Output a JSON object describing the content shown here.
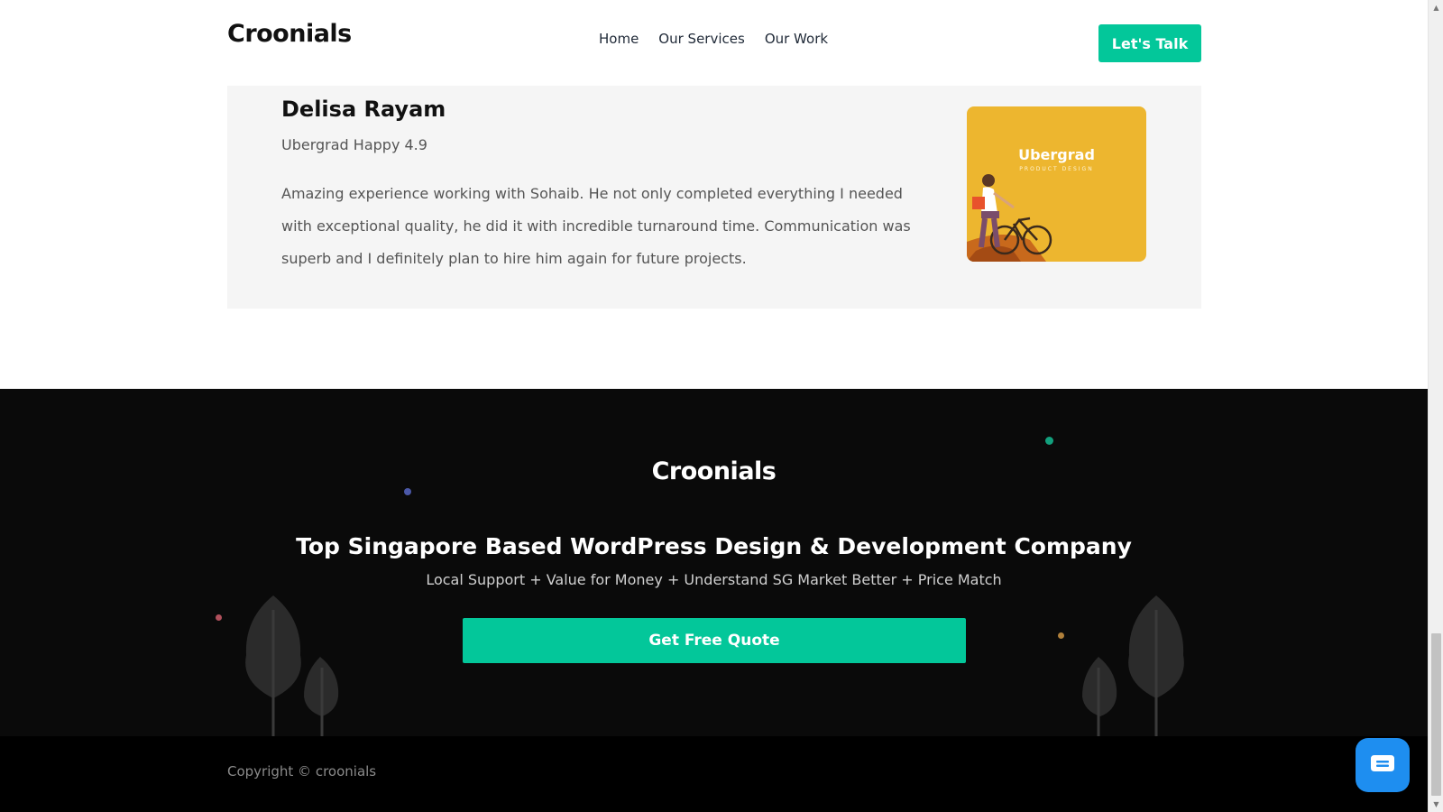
{
  "header": {
    "logo": "Croonials",
    "nav": [
      "Home",
      "Our Services",
      "Our Work"
    ],
    "cta": "Let's Talk"
  },
  "testimonial": {
    "name": "Delisa Rayam",
    "rating": "Ubergrad Happy 4.9",
    "review": "Amazing experience working with Sohaib. He not only completed everything I needed with exceptional quality, he did it with incredible turnaround time. Communication was superb and I definitely plan to hire him again for future projects.",
    "image": {
      "title": "Ubergrad",
      "subtitle": "PRODUCT DESIGN"
    }
  },
  "footer": {
    "logo": "Croonials",
    "title": "Top Singapore Based WordPress Design & Development Company",
    "subtitle": "Local Support + Value for Money + Understand SG Market Better + Price Match",
    "cta": "Get Free Quote",
    "copyright": "Copyright © croonials"
  },
  "colors": {
    "accent": "#03c79a",
    "footer_bg": "#0a0a0a",
    "card_bg": "#f5f5f5",
    "thumb_bg": "#edb62f",
    "chat_bg": "#1e8ef0"
  },
  "icons": [
    "chat-icon",
    "tree-icon",
    "cyclist-illustration"
  ]
}
